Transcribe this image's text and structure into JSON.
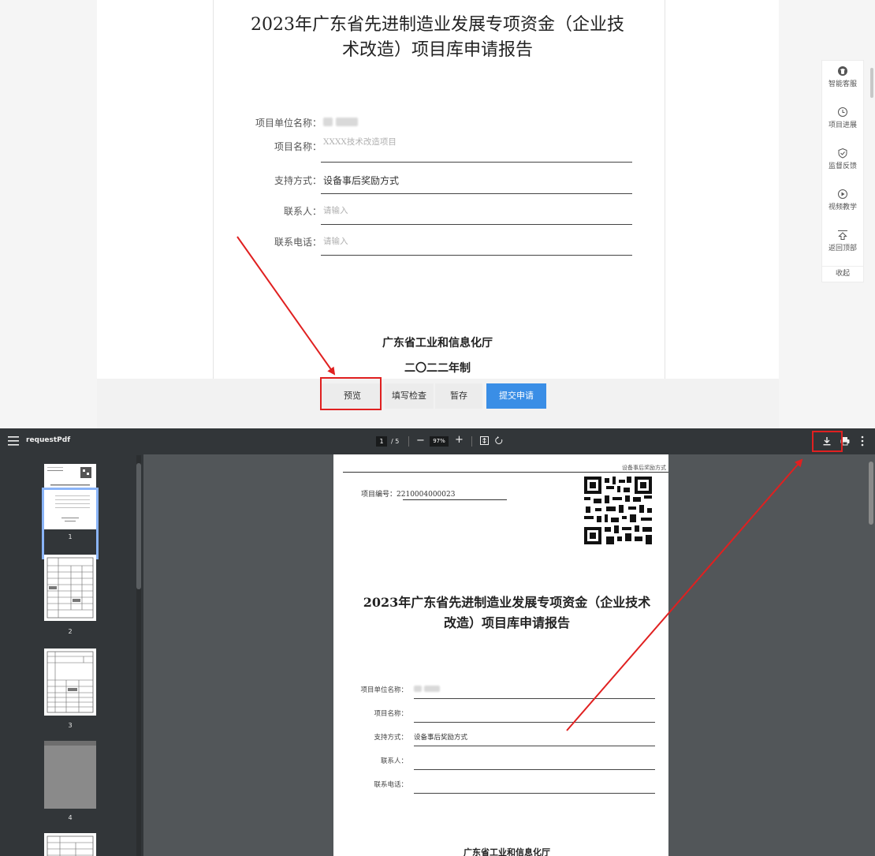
{
  "form": {
    "title_line1": "2023年广东省先进制造业发展专项资金（企业技",
    "title_line2": "术改造）项目库申请报告",
    "fields": [
      {
        "label": "项目单位名称：",
        "value": "",
        "placeholder": ""
      },
      {
        "label": "项目名称：",
        "value": "",
        "placeholder": "XXXX技术改造项目"
      },
      {
        "label": "支持方式：",
        "value": "设备事后奖励方式",
        "placeholder": ""
      },
      {
        "label": "联系人：",
        "value": "",
        "placeholder": "请输入"
      },
      {
        "label": "联系电话：",
        "value": "",
        "placeholder": "请输入"
      }
    ],
    "issuer": "广东省工业和信息化厅",
    "year": "二〇二二年制",
    "buttons": {
      "preview": "预览",
      "check": "填写检查",
      "save": "暂存",
      "submit": "提交申请"
    }
  },
  "side_panel": {
    "items": [
      {
        "label": "智能客服",
        "icon": "headset-icon"
      },
      {
        "label": "项目进展",
        "icon": "clock-icon"
      },
      {
        "label": "监督反馈",
        "icon": "shield-check-icon"
      },
      {
        "label": "视频教学",
        "icon": "play-icon"
      },
      {
        "label": "返回顶部",
        "icon": "arrow-up-icon"
      }
    ],
    "collapse": "收起"
  },
  "viewer": {
    "title": "requestPdf",
    "current_page": "1",
    "total_pages": "/ 5",
    "zoom": "97%",
    "zoom_out": "−",
    "zoom_in": "+",
    "thumbnails": [
      "1",
      "2",
      "3",
      "4"
    ],
    "pdf": {
      "header": "设备事后奖励方式",
      "project_no_label": "项目编号：",
      "project_no": "2210004000023",
      "title_line1": "2023年广东省先进制造业发展专项资金（企业技术",
      "title_line2": "改造）项目库申请报告",
      "fields": [
        {
          "label": "项目单位名称：",
          "value": ""
        },
        {
          "label": "项目名称：",
          "value": ""
        },
        {
          "label": "支持方式：",
          "value": "设备事后奖励方式"
        },
        {
          "label": "联系人：",
          "value": ""
        },
        {
          "label": "联系电话：",
          "value": ""
        }
      ],
      "issuer": "广东省工业和信息化厅"
    }
  },
  "colors": {
    "submit_blue": "#3a8ee6",
    "highlight_red": "#e02020",
    "viewer_toolbar": "#323639",
    "viewer_bg": "#525659"
  }
}
